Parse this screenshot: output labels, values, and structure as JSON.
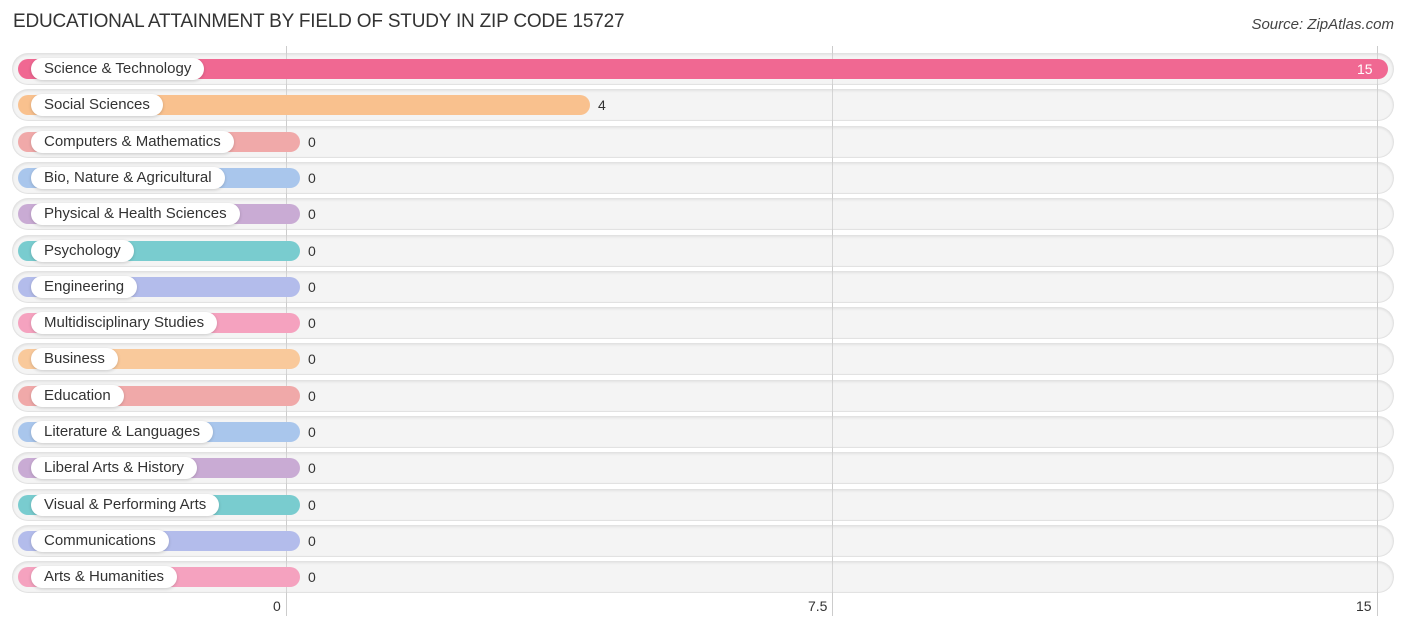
{
  "header": {
    "title": "EDUCATIONAL ATTAINMENT BY FIELD OF STUDY IN ZIP CODE 15727",
    "source": "Source: ZipAtlas.com"
  },
  "chart_data": {
    "type": "bar",
    "orientation": "horizontal",
    "title": "EDUCATIONAL ATTAINMENT BY FIELD OF STUDY IN ZIP CODE 15727",
    "xlabel": "",
    "ylabel": "",
    "xlim": [
      0,
      15
    ],
    "x_ticks": [
      "0",
      "7.5",
      "15"
    ],
    "x_tick_values": [
      0,
      7.5,
      15
    ],
    "grid": true,
    "categories": [
      "Science & Technology",
      "Social Sciences",
      "Computers & Mathematics",
      "Bio, Nature & Agricultural",
      "Physical & Health Sciences",
      "Psychology",
      "Engineering",
      "Multidisciplinary Studies",
      "Business",
      "Education",
      "Literature & Languages",
      "Liberal Arts & History",
      "Visual & Performing Arts",
      "Communications",
      "Arts & Humanities"
    ],
    "values": [
      15,
      4,
      0,
      0,
      0,
      0,
      0,
      0,
      0,
      0,
      0,
      0,
      0,
      0,
      0
    ],
    "value_labels": [
      "15",
      "4",
      "0",
      "0",
      "0",
      "0",
      "0",
      "0",
      "0",
      "0",
      "0",
      "0",
      "0",
      "0",
      "0"
    ],
    "colors": [
      "#f06892",
      "#f9c18e",
      "#f0a9a9",
      "#a9c6ec",
      "#c9abd4",
      "#79cccf",
      "#b3bceb",
      "#f5a2bf",
      "#f9c99b",
      "#f0a9a9",
      "#a9c6ec",
      "#c9abd4",
      "#79cccf",
      "#b3bceb",
      "#f5a2bf"
    ]
  }
}
